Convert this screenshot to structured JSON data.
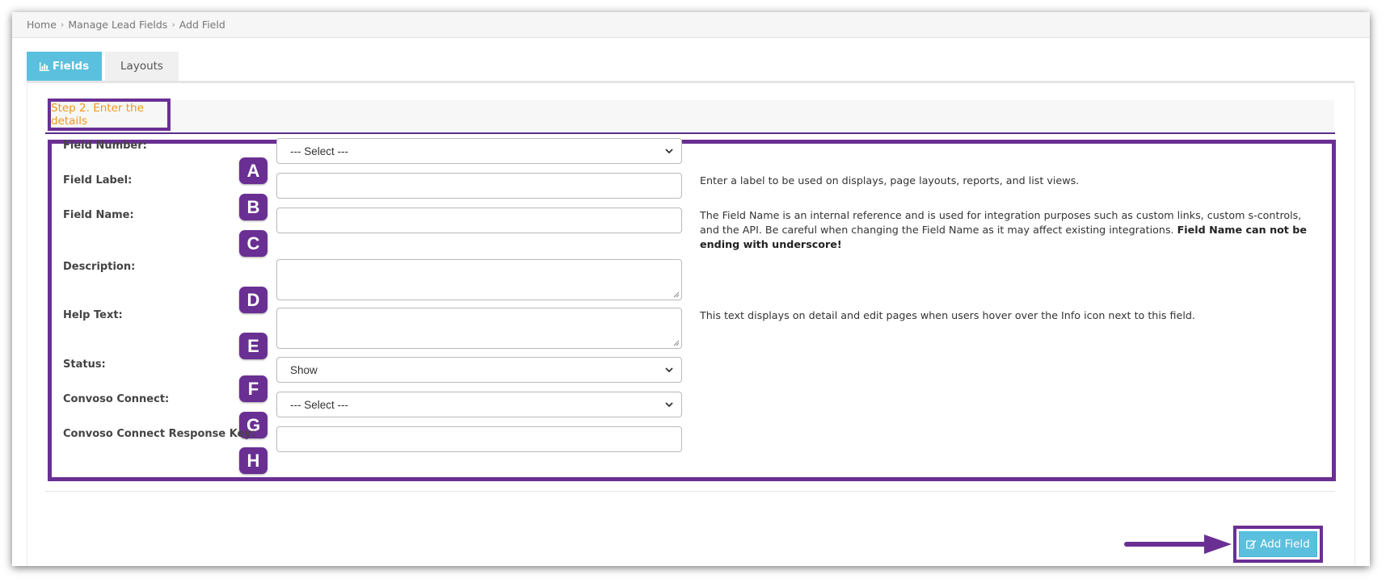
{
  "breadcrumb": [
    "Home",
    "Manage Lead Fields",
    "Add Field"
  ],
  "tabs": [
    {
      "label": "Fields",
      "icon": "bar-chart-icon",
      "active": true
    },
    {
      "label": "Layouts",
      "active": false
    }
  ],
  "step_title": "Step 2. Enter the details",
  "fields": {
    "field_number": {
      "label": "Field Number:",
      "badge": "A",
      "value": "--- Select ---"
    },
    "field_label": {
      "label": "Field Label:",
      "badge": "B",
      "value": "",
      "help": "Enter a label to be used on displays, page layouts, reports, and list views."
    },
    "field_name": {
      "label": "Field Name:",
      "badge": "C",
      "value": "",
      "help": "The Field Name is an internal reference and is used for integration purposes such as custom links, custom s-controls, and the API. Be careful when changing the Field Name as it may affect existing integrations.",
      "help_bold": "Field Name can not be ending with underscore!"
    },
    "description": {
      "label": "Description:",
      "badge": "D",
      "value": ""
    },
    "help_text": {
      "label": "Help Text:",
      "badge": "E",
      "value": "",
      "help": "This text displays on detail and edit pages when users hover over the Info icon next to this field."
    },
    "status": {
      "label": "Status:",
      "badge": "F",
      "value": "Show"
    },
    "convoso_connect": {
      "label": "Convoso Connect:",
      "badge": "G",
      "value": "--- Select ---"
    },
    "response_key": {
      "label": "Convoso Connect Response Key:",
      "badge": "H",
      "value": ""
    }
  },
  "add_button": {
    "label": "Add Field",
    "icon": "edit-icon"
  },
  "colors": {
    "accent": "#5bc0de",
    "annotation": "#6a2f93",
    "step_title": "#f0961d"
  }
}
